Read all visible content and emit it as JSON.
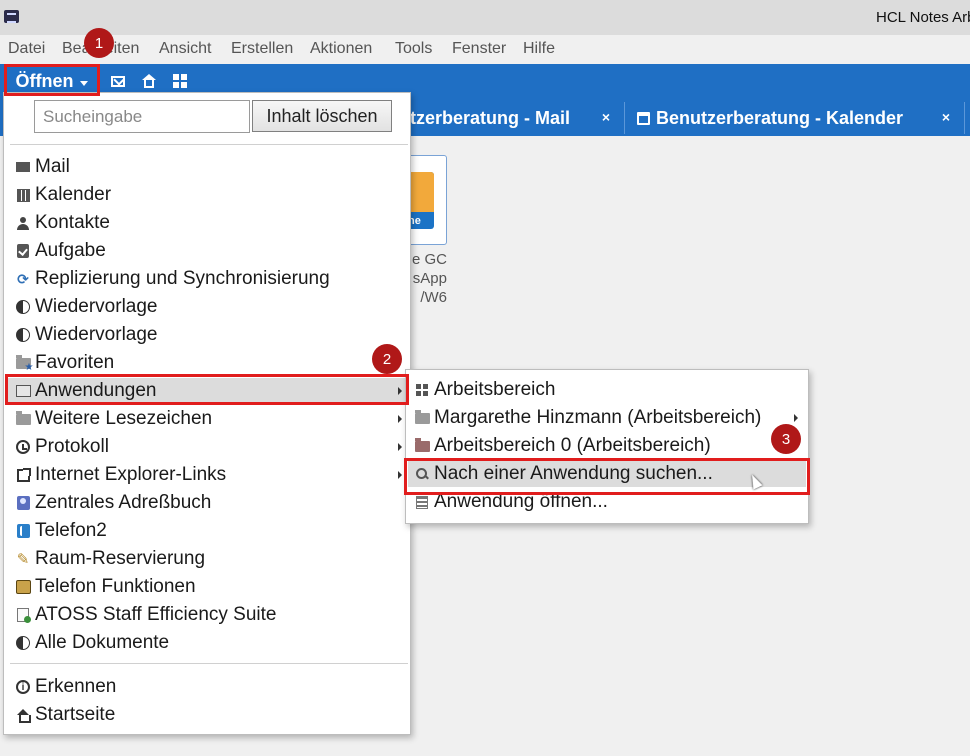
{
  "window": {
    "title": "HCL Notes Arb"
  },
  "menubar": [
    "Datei",
    "Bearbeiten",
    "Ansicht",
    "Erstellen",
    "Aktionen",
    "Tools",
    "Fenster",
    "Hilfe"
  ],
  "toolbar": {
    "open_label": "Öffnen"
  },
  "tabs": [
    {
      "label": "tzerberatung - Mail",
      "close": "×"
    },
    {
      "label": "Benutzerberatung - Kalender",
      "close": "×"
    }
  ],
  "app_tile": {
    "tile_text": "ne",
    "caption": [
      "e GC",
      "sApp",
      "/W6"
    ]
  },
  "open_menu": {
    "search_placeholder": "Sucheingabe",
    "clear_label": "Inhalt löschen",
    "items": [
      "Mail",
      "Kalender",
      "Kontakte",
      "Aufgabe",
      "Replizierung und Synchronisierung",
      "Wiedervorlage",
      "Wiedervorlage",
      "Favoriten",
      "Anwendungen",
      "Weitere Lesezeichen",
      "Protokoll",
      "Internet Explorer-Links",
      "Zentrales Adreßbuch",
      "Telefon2",
      "Raum-Reservierung",
      "Telefon Funktionen",
      "ATOSS Staff Efficiency Suite",
      "Alle Dokumente",
      "Erkennen",
      "Startseite"
    ]
  },
  "applications_submenu": {
    "items": [
      "Arbeitsbereich",
      "Margarethe Hinzmann (Arbeitsbereich)",
      "Arbeitsbereich 0 (Arbeitsbereich)",
      "Nach einer Anwendung suchen...",
      "Anwendung öffnen..."
    ]
  },
  "annotations": {
    "badges": [
      "1",
      "2",
      "3"
    ],
    "color": "#e11d1d"
  }
}
